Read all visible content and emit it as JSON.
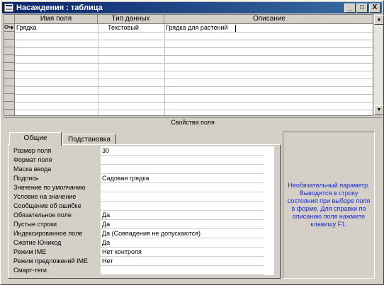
{
  "window": {
    "title": "Насаждения : таблица",
    "buttons": {
      "minimize": "_",
      "maximize": "□",
      "close": "X"
    }
  },
  "grid": {
    "columns": [
      "Имя поля",
      "Тип данных",
      "Описание"
    ],
    "rows": [
      {
        "name": "Грядка",
        "type": "Текстовый",
        "description": "Грядка для растений"
      }
    ]
  },
  "properties": {
    "caption": "Свойства поля",
    "tabs": [
      "Общие",
      "Подстановка"
    ],
    "active_tab": "Общие",
    "fields": [
      {
        "label": "Размер поля",
        "value": "30"
      },
      {
        "label": "Формат поля",
        "value": ""
      },
      {
        "label": "Маска ввода",
        "value": ""
      },
      {
        "label": "Подпись",
        "value": "Садовая грядка"
      },
      {
        "label": "Значение по умолчанию",
        "value": ""
      },
      {
        "label": "Условие на значение",
        "value": ""
      },
      {
        "label": "Сообщение об ошибке",
        "value": ""
      },
      {
        "label": "Обязательное поле",
        "value": "Да"
      },
      {
        "label": "Пустые строки",
        "value": "Да"
      },
      {
        "label": "Индексированное поле",
        "value": "Да (Совпадения не допускаются)"
      },
      {
        "label": "Сжатие Юникод",
        "value": "Да"
      },
      {
        "label": "Режим IME",
        "value": "Нет контроля"
      },
      {
        "label": "Режим предложений IME",
        "value": "Нет"
      },
      {
        "label": "Смарт-теги",
        "value": ""
      }
    ],
    "hint": "Необязательный параметр. Выводится в строку состояния при выборе поля в форме. Для справки по описанию поля нажмите клавишу F1."
  },
  "colors": {
    "titlebar_start": "#0a246a",
    "titlebar_end": "#3a6ea5",
    "hint_text": "#1a2ad8",
    "face": "#d4d0c8"
  },
  "icons": [
    "table-icon",
    "primary-key-icon",
    "row-pointer-icon",
    "scroll-up-icon",
    "scroll-down-icon"
  ]
}
